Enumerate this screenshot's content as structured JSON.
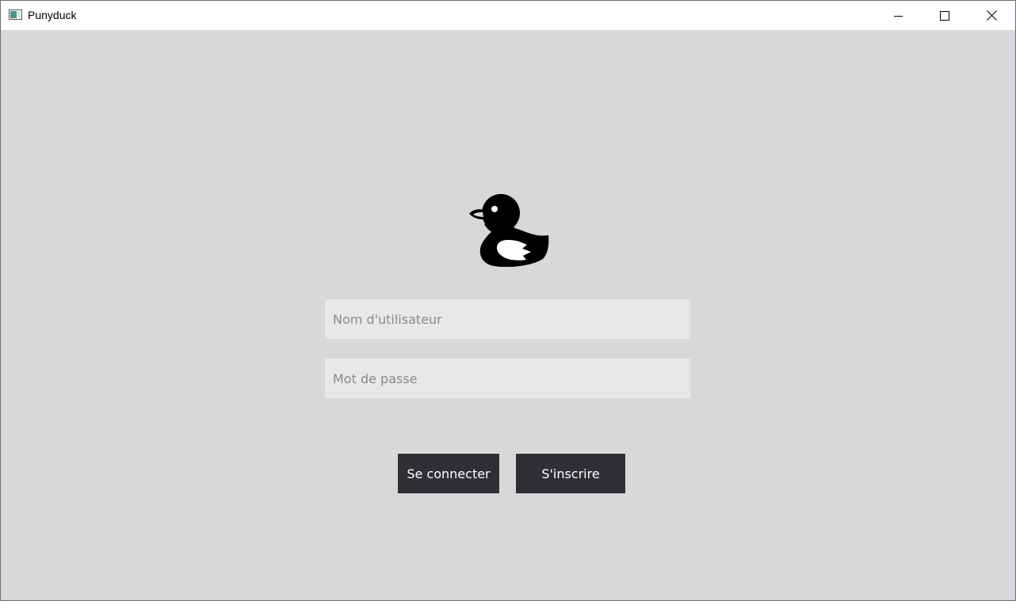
{
  "window": {
    "title": "Punyduck",
    "icons": {
      "app": "app-window-icon",
      "minimize": "minimize-icon",
      "maximize": "maximize-icon",
      "close": "close-icon"
    }
  },
  "login": {
    "logo_icon": "duck-icon",
    "username": {
      "placeholder": "Nom d'utilisateur",
      "value": ""
    },
    "password": {
      "placeholder": "Mot de passe",
      "value": ""
    },
    "login_button": "Se connecter",
    "signup_button": "S'inscrire"
  },
  "colors": {
    "background": "#d8d8d8",
    "input_background": "#e8e8e8",
    "button_background": "#2f3035",
    "button_text": "#ffffff",
    "placeholder_text": "#8a8a8a"
  }
}
